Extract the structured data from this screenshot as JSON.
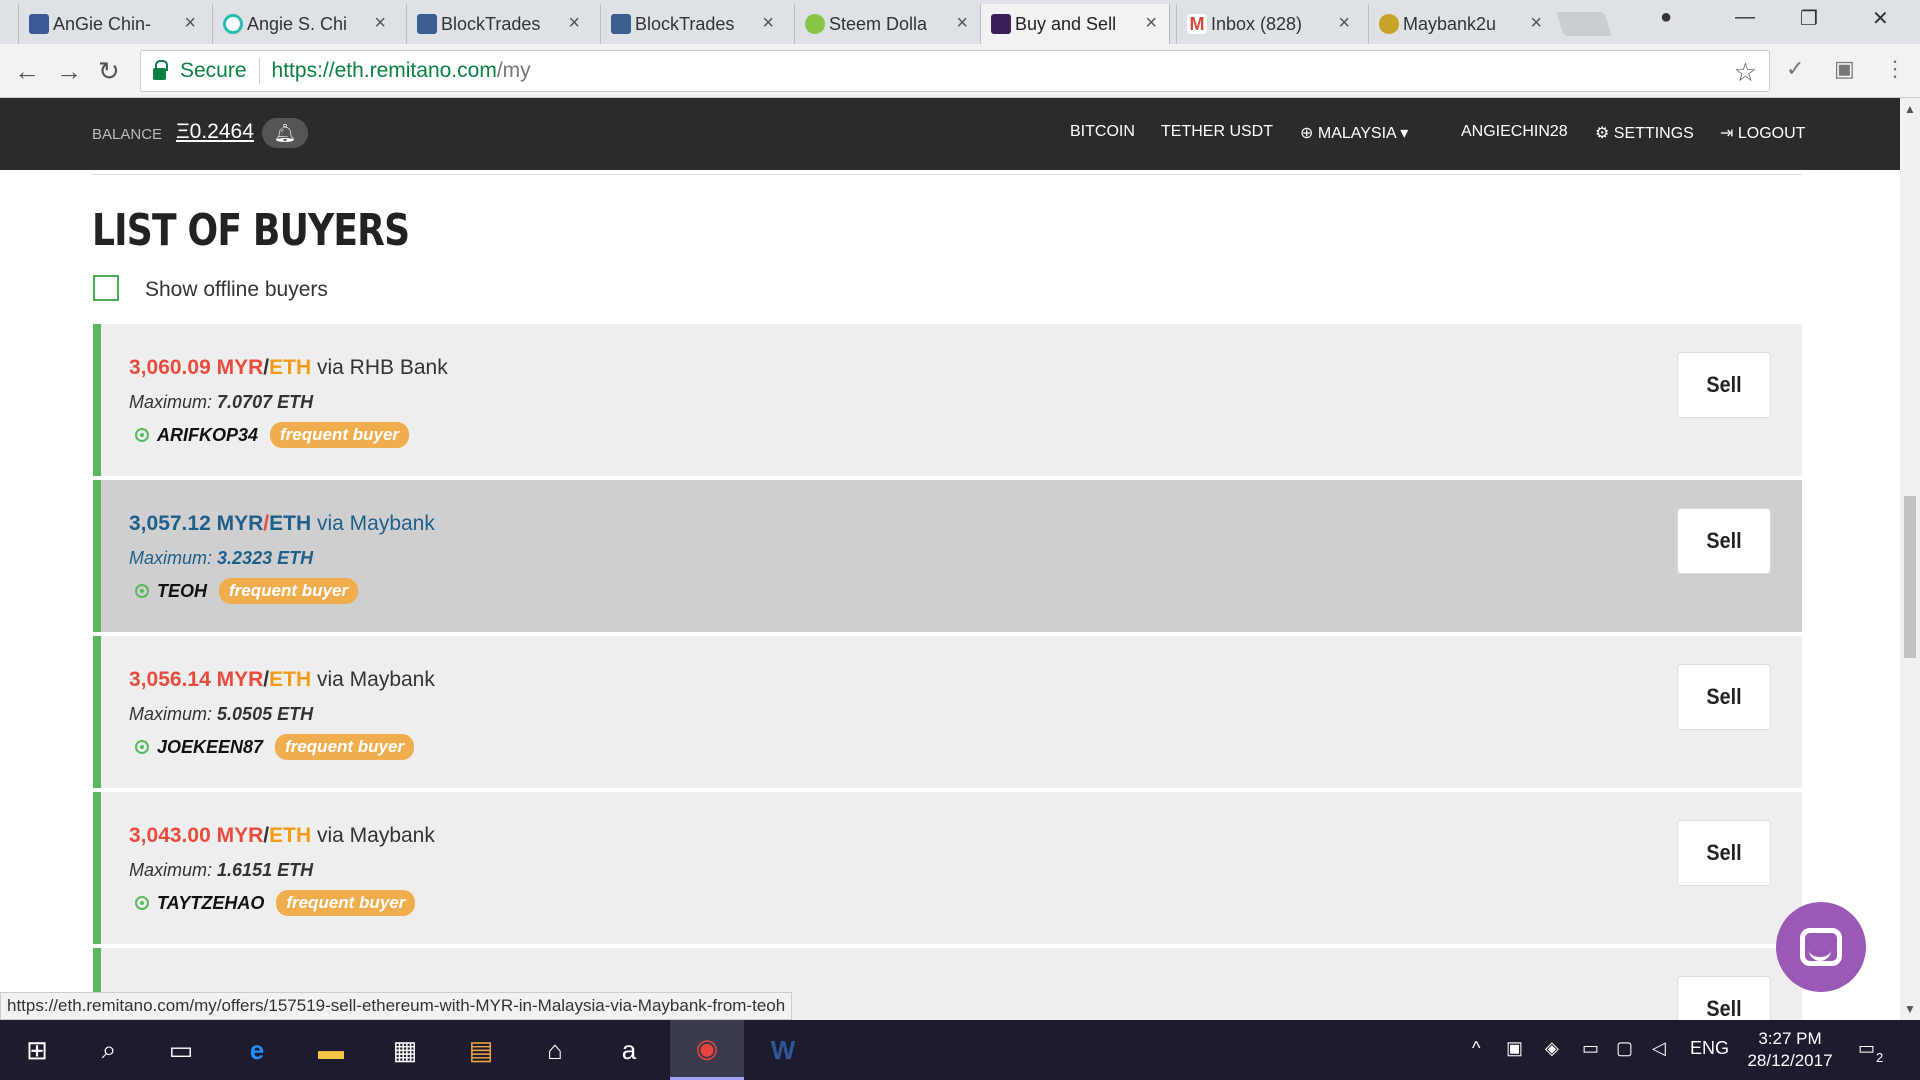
{
  "browser": {
    "tabs": [
      {
        "title": "AnGie Chin-",
        "icon": "facebook-icon",
        "color": "#3b5998"
      },
      {
        "title": "Angie S. Chi",
        "icon": "circle-icon",
        "color": "#2bbbad"
      },
      {
        "title": "BlockTrades",
        "icon": "blocktrades-icon",
        "color": "#3a5f8f"
      },
      {
        "title": "BlockTrades",
        "icon": "blocktrades-icon",
        "color": "#3a5f8f"
      },
      {
        "title": "Steem Dolla",
        "icon": "steem-icon",
        "color": "#8bc34a"
      },
      {
        "title": "Buy and Sell",
        "icon": "remitano-icon",
        "color": "#3c1e5a"
      },
      {
        "title": "Inbox (828)",
        "icon": "gmail-icon",
        "color": "#d44638"
      },
      {
        "title": "Maybank2u",
        "icon": "maybank-icon",
        "color": "#c9a227"
      }
    ],
    "active_tab": 5,
    "secure_label": "Secure",
    "url_host": "https://eth.remitano.com",
    "url_path": "/my",
    "status_url": "https://eth.remitano.com/my/offers/157519-sell-ethereum-with-MYR-in-Malaysia-via-Maybank-from-teoh"
  },
  "header": {
    "balance_label": "BALANCE",
    "balance_value": "Ξ0.2464",
    "nav": [
      "BITCOIN",
      "TETHER USDT",
      "MALAYSIA",
      "ANGIECHIN28",
      "SETTINGS",
      "LOGOUT"
    ]
  },
  "main": {
    "title": "LIST OF BUYERS",
    "offline_label": "Show offline buyers",
    "via": "via",
    "max_label": "Maximum:",
    "sell_label": "Sell",
    "badge_label": "frequent buyer",
    "offers": [
      {
        "price": "3,060.09",
        "fiat": "MYR",
        "coin": "ETH",
        "bank": "RHB Bank",
        "max": "7.0707 ETH",
        "user": "ARIFKOP34"
      },
      {
        "price": "3,057.12",
        "fiat": "MYR",
        "coin": "ETH",
        "bank": "Maybank",
        "max": "3.2323 ETH",
        "user": "TEOH"
      },
      {
        "price": "3,056.14",
        "fiat": "MYR",
        "coin": "ETH",
        "bank": "Maybank",
        "max": "5.0505 ETH",
        "user": "JOEKEEN87"
      },
      {
        "price": "3,043.00",
        "fiat": "MYR",
        "coin": "ETH",
        "bank": "Maybank",
        "max": "1.6151 ETH",
        "user": "TAYTZEHAO"
      }
    ],
    "hovered_offer": 1
  },
  "taskbar": {
    "language": "ENG",
    "time": "3:27 PM",
    "date": "28/12/2017",
    "notifications": "2"
  },
  "colors": {
    "accent_green": "#5cb85c",
    "price_red": "#e74c3c",
    "coin_orange": "#f39c12",
    "badge_orange": "#f0ad4e",
    "header_dark": "#2b2b2b"
  }
}
